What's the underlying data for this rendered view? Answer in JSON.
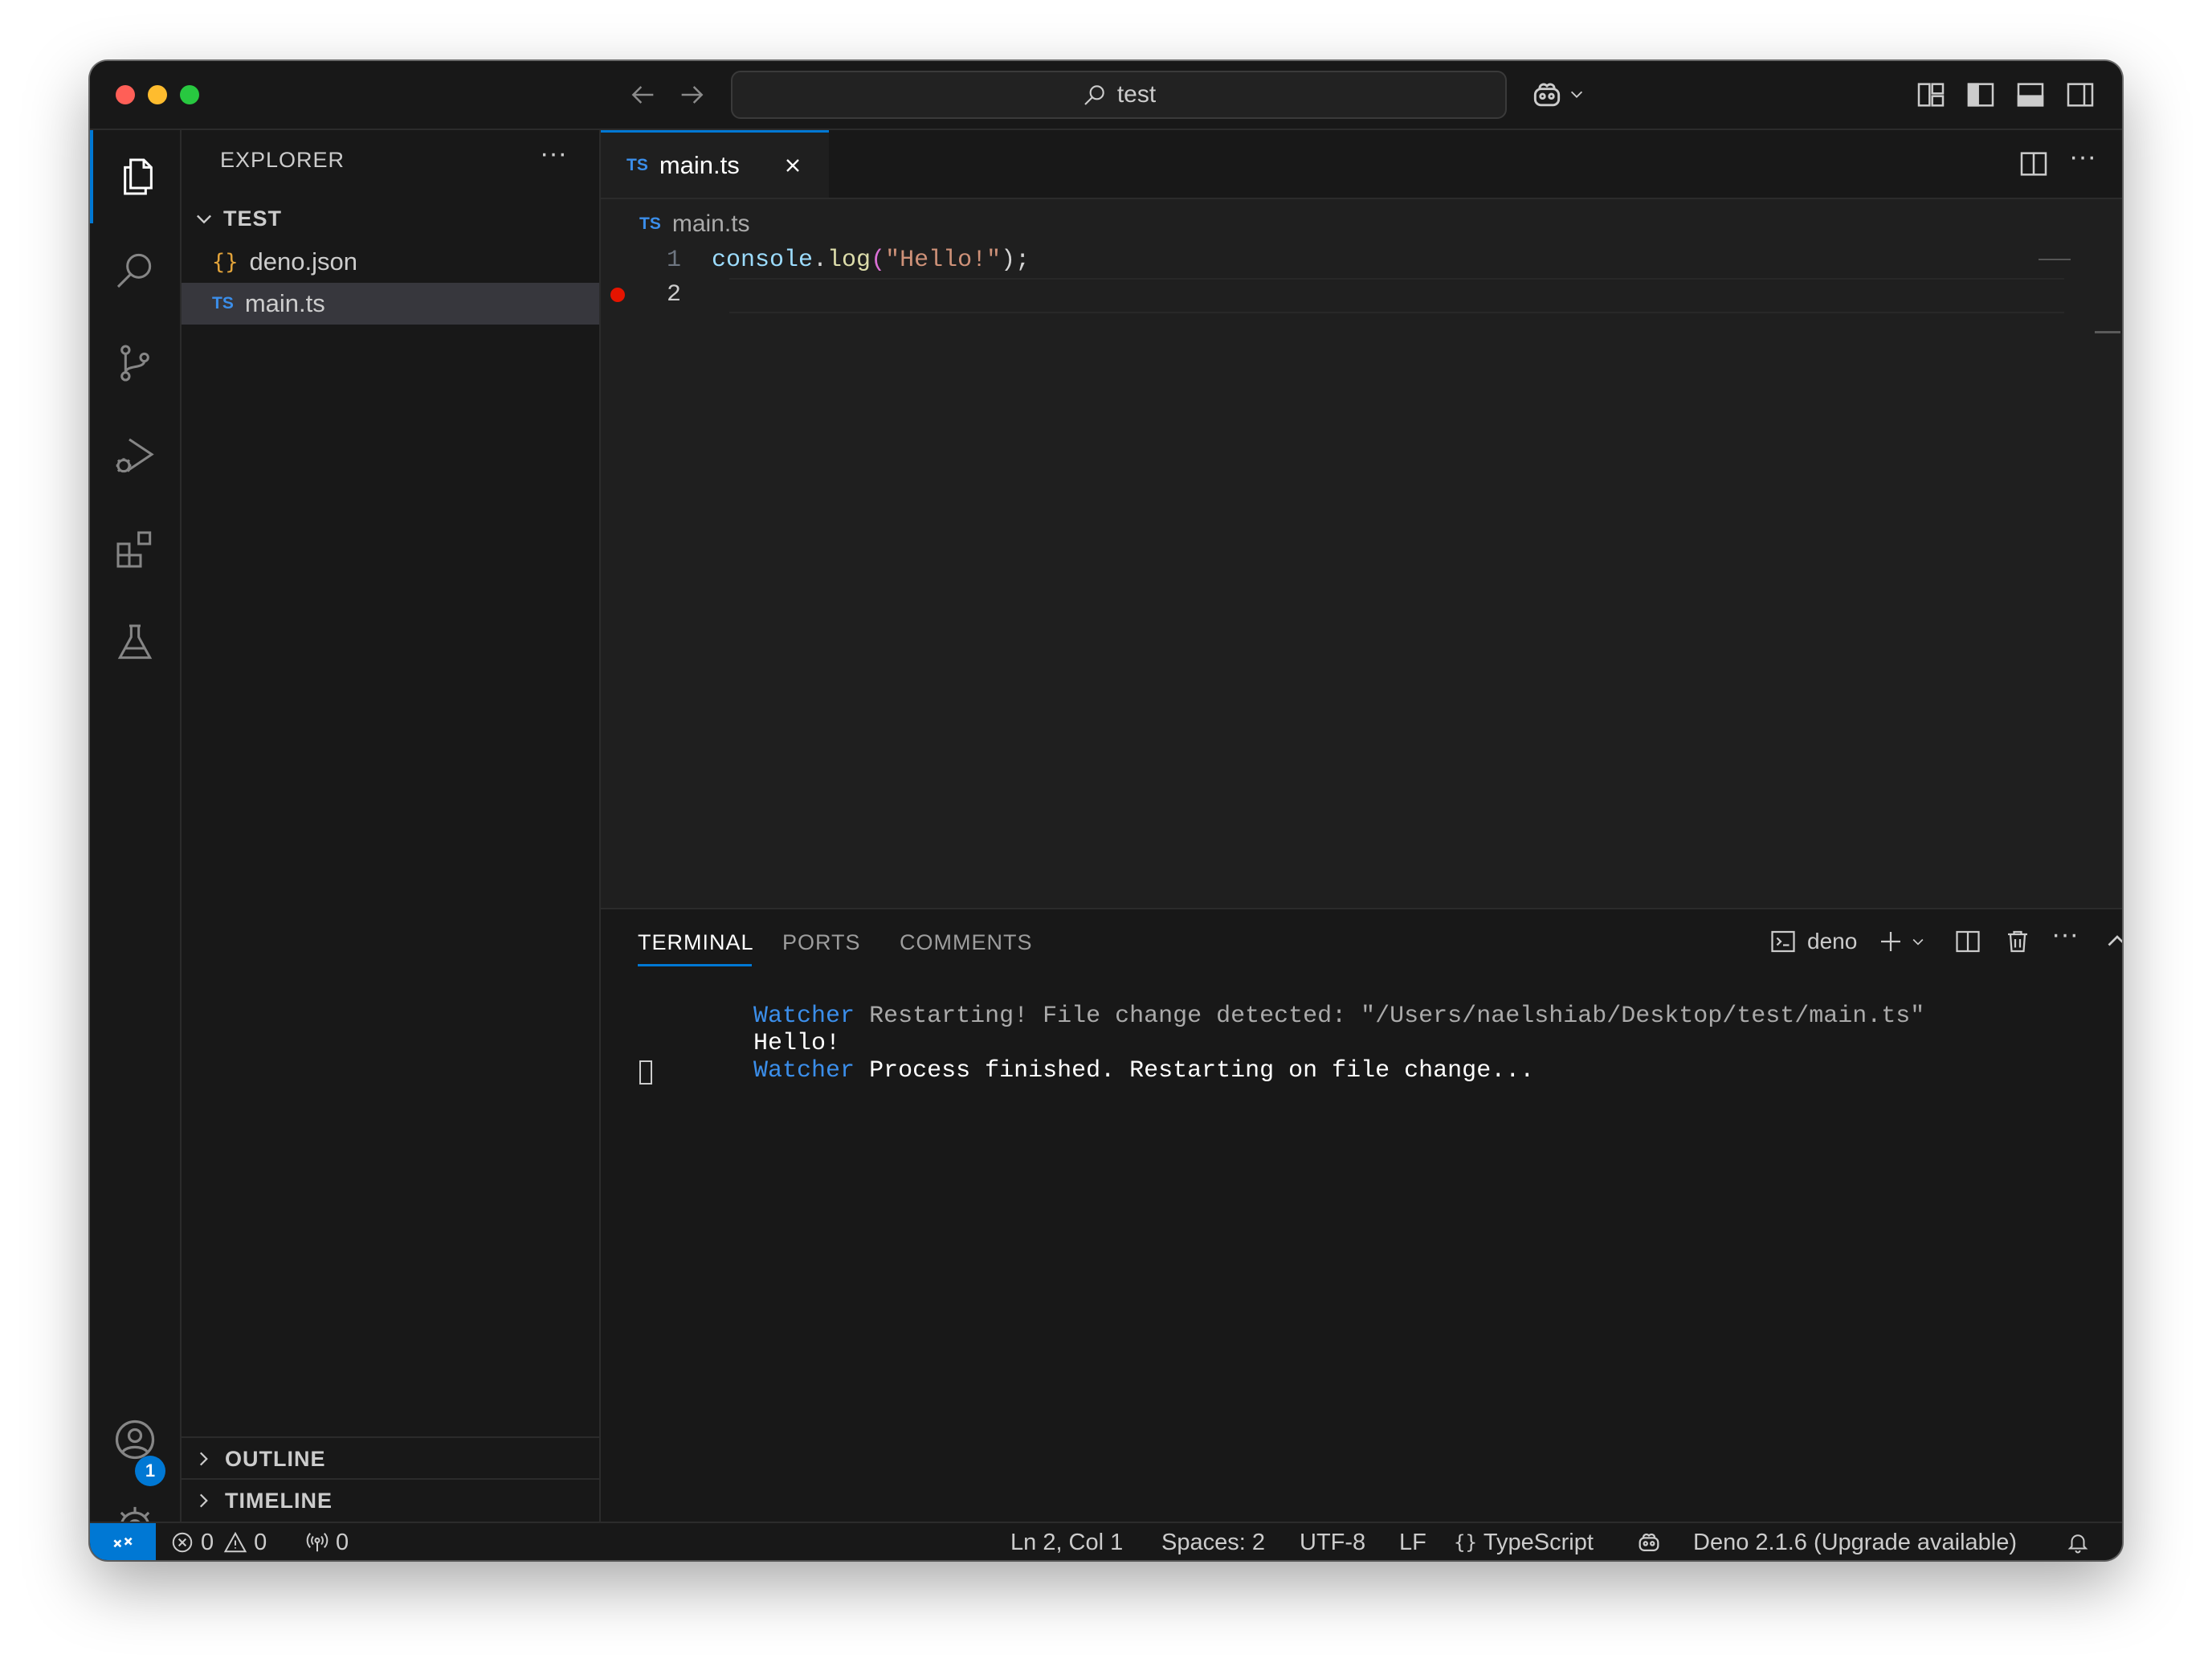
{
  "titlebar": {
    "search_text": "test"
  },
  "explorer": {
    "title": "EXPLORER",
    "folder": "TEST",
    "files": [
      {
        "badge": "{}",
        "name": "deno.json"
      },
      {
        "badge": "TS",
        "name": "main.ts"
      }
    ],
    "outline_label": "OUTLINE",
    "timeline_label": "TIMELINE"
  },
  "activity": {
    "accounts_badge": "1"
  },
  "editor": {
    "tab_badge": "TS",
    "tab_label": "main.ts",
    "breadcrumb_badge": "TS",
    "breadcrumb_file": "main.ts",
    "lines": [
      {
        "num": "1",
        "obj": "console",
        "dot": ".",
        "fn": "log",
        "open": "(",
        "str": "\"Hello!\"",
        "close": ");"
      },
      {
        "num": "2"
      }
    ]
  },
  "panel": {
    "tabs": [
      "TERMINAL",
      "PORTS",
      "COMMENTS"
    ],
    "terminal_name": "deno",
    "lines": [
      {
        "prefix": "Watcher",
        "text": " Restarting! File change detected: \"/Users/naelshiab/Desktop/test/main.ts\""
      },
      {
        "prefix": "",
        "text": "Hello!"
      },
      {
        "prefix": "Watcher",
        "text": " Process finished. Restarting on file change..."
      }
    ]
  },
  "status": {
    "errors": "0",
    "warnings": "0",
    "ports": "0",
    "position": "Ln 2, Col 1",
    "spaces": "Spaces: 2",
    "encoding": "UTF-8",
    "eol": "LF",
    "language_braces": "{}",
    "language": "TypeScript",
    "deno": "Deno 2.1.6 (Upgrade available)"
  },
  "colors": {
    "accent": "#0078d4",
    "breakpoint": "#e51400",
    "ts_badge": "#3b8eea",
    "json_badge": "#e2a33a",
    "watcher": "#3b8eea"
  }
}
